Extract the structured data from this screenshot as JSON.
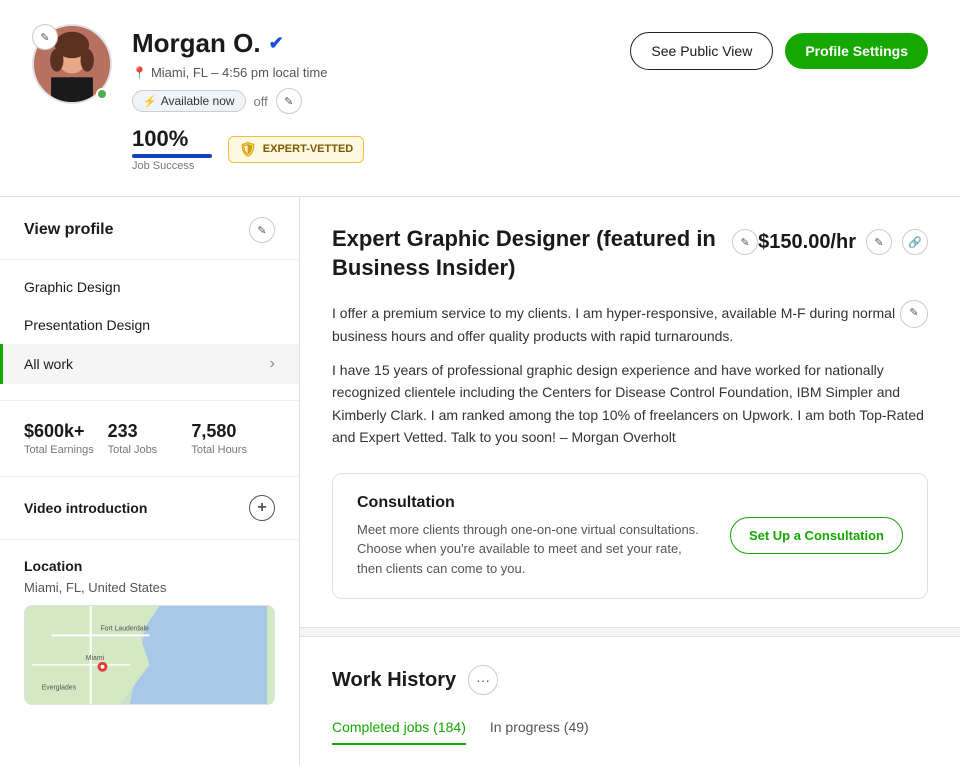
{
  "header": {
    "name": "Morgan O.",
    "verified": true,
    "location": "Miami, FL – 4:56 pm local time",
    "availability_label": "Available now",
    "availability_state": "off",
    "job_success_percent": "100%",
    "job_success_bar_width": "100",
    "job_success_label": "Job Success",
    "expert_vetted_label": "EXPERT-VETTED",
    "btn_public_view": "See Public View",
    "btn_profile_settings": "Profile Settings"
  },
  "sidebar": {
    "view_profile_title": "View profile",
    "nav_items": [
      {
        "label": "Graphic Design",
        "active": false
      },
      {
        "label": "Presentation Design",
        "active": false
      },
      {
        "label": "All work",
        "active": true,
        "has_chevron": true
      }
    ],
    "stats": [
      {
        "value": "$600k+",
        "label": "Total Earnings"
      },
      {
        "value": "233",
        "label": "Total Jobs"
      },
      {
        "value": "7,580",
        "label": "Total Hours"
      }
    ],
    "video_intro_label": "Video introduction",
    "location_section_title": "Location",
    "location_text": "Miami, FL, United States"
  },
  "profile": {
    "title": "Expert Graphic Designer (featured in Business Insider)",
    "rate": "$150.00/hr",
    "bio_paragraph1": "I offer a premium service to my clients. I am hyper-responsive, available M-F during normal business hours and offer quality products with rapid turnarounds.",
    "bio_paragraph2": "I have 15 years of professional graphic design experience and have worked for nationally recognized clientele including the Centers for Disease Control Foundation, IBM Simpler and Kimberly Clark. I am ranked among the top 10% of freelancers on Upwork. I am both Top-Rated and Expert Vetted. Talk to you soon! – Morgan Overholt"
  },
  "consultation": {
    "title": "Consultation",
    "description": "Meet more clients through one-on-one virtual consultations. Choose when you're available to meet and set your rate, then clients can come to you.",
    "btn_label": "Set Up a Consultation"
  },
  "work_history": {
    "title": "Work History",
    "tabs": [
      {
        "label": "Completed jobs",
        "count": "184",
        "active": true
      },
      {
        "label": "In progress",
        "count": "49",
        "active": false
      }
    ]
  },
  "colors": {
    "green": "#14a800",
    "blue": "#1641c1",
    "gold": "#d4a000"
  }
}
